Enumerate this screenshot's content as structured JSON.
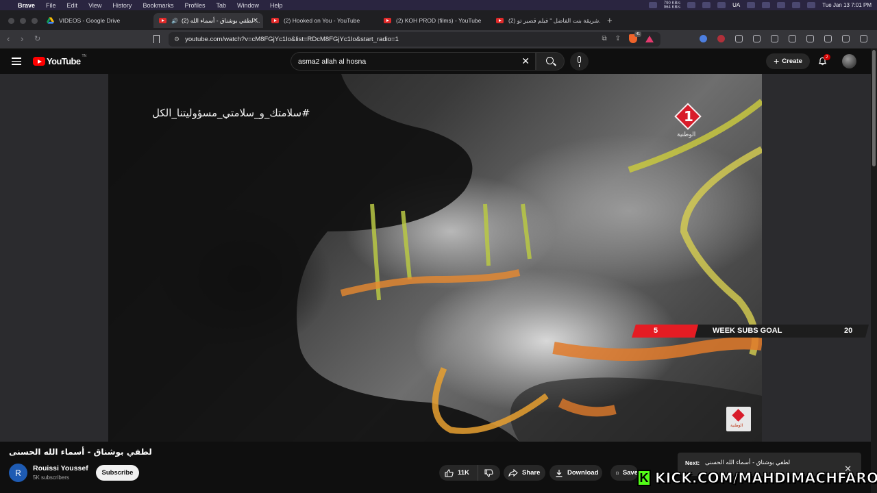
{
  "menubar": {
    "app_name": "Brave",
    "items": [
      "File",
      "Edit",
      "View",
      "History",
      "Bookmarks",
      "Profiles",
      "Tab",
      "Window",
      "Help"
    ],
    "net_up": "790 KB/s",
    "net_down": "964 KB/s",
    "input_source": "UA",
    "clock": "Tue Jan 13  7:01 PM"
  },
  "tabs": [
    {
      "title": "VIDEOS - Google Drive",
      "icon": "google-drive-icon",
      "active": false
    },
    {
      "title": "(2) لطفي بوشناق - أسماء الله ...",
      "icon": "youtube-icon",
      "active": true
    },
    {
      "title": "(2) Hooked on You - YouTube",
      "icon": "youtube-icon",
      "active": false
    },
    {
      "title": "(2) KOH PROD (films) - YouTube",
      "icon": "youtube-icon",
      "active": false
    },
    {
      "title": "(2) شريقة بنت الفاضل \" فيلم قصير تو...",
      "icon": "youtube-icon",
      "active": false
    }
  ],
  "address_bar": {
    "url": "youtube.com/watch?v=cM8FGjYc1Io&list=RDcM8FGjYc1Io&start_radio=1",
    "shield_count": "41"
  },
  "youtube": {
    "logo_text": "YouTube",
    "logo_region": "TN",
    "search_value": "asma2 allah al hosna",
    "create_label": "Create",
    "notification_count": "2"
  },
  "video": {
    "caption_text": "#سلامتك_و_سلامتي_مسؤوليتنا_الكل",
    "channel_logo_number": "1",
    "channel_logo_text": "الوطنية",
    "title": "لطفي بوشناق - أسماء الله الحسنى",
    "channel_initial": "R",
    "channel_name": "Rouissi Youssef",
    "channel_subs": "5K subscribers",
    "subscribe_label": "Subscribe",
    "likes": "11K",
    "share_label": "Share",
    "download_label": "Download",
    "save_label": "Save"
  },
  "subs_goal": {
    "current": "5",
    "label": "WEEK SUBS GOAL",
    "target": "20"
  },
  "next_up": {
    "label": "Next:",
    "title": "لطفي بوشناق - أسماء الله الحسنى"
  },
  "kick": {
    "logo": "K",
    "text": "KICK.COM/MAHDIMACHFAROTB"
  },
  "colors": {
    "youtube_red": "#ff0000",
    "subs_goal_red": "#e51c23",
    "kick_green": "#53fc18"
  }
}
